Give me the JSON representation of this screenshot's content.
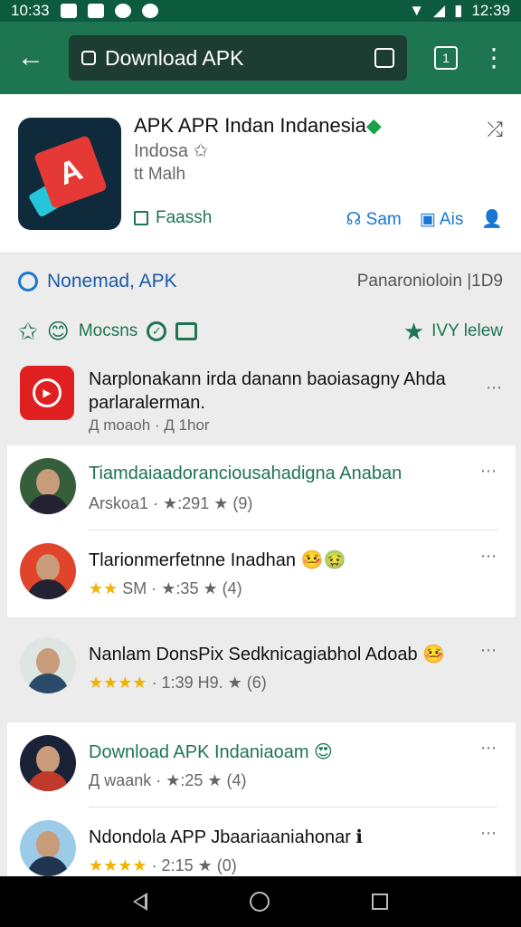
{
  "statusbar": {
    "left_time": "10:33",
    "right_time": "12:39"
  },
  "toolbar": {
    "title": "Download APK"
  },
  "app": {
    "name": "APK APR Indan Indanesia",
    "subtitle": "Indosa",
    "developer": "tt Malh",
    "fresh_label": "Faassh",
    "action_1": "Sam",
    "action_2": "Ais"
  },
  "section": {
    "title": "Nonemad, APK",
    "right": "Panaronioloin |1D9"
  },
  "filters": {
    "label": "Mocsns",
    "right": "IVY lelew"
  },
  "featured": {
    "title": "Narplonakann irda danann baoiasagny Ahda parlaralerman.",
    "meta": "Д moaoh · Д 1hor"
  },
  "items": [
    {
      "name": "Tiamdaiaadoranciousahadigna Anaban",
      "meta": "Arskoa1 · ★:291 ★ (9)"
    },
    {
      "name": "Tlarionmerfetnne Inadhan 🤒🤢",
      "stars": "★★",
      "meta": "SM · ★:35 ★ (4)"
    },
    {
      "name": "Nanlam DonsPix Sedknicagiabhol Adoab 🤒",
      "stars": "★★★★",
      "meta": "· 1:39 H9. ★ (6)"
    },
    {
      "name": "Download APK Indaniaoam 😍",
      "meta": "Д waank · ★:25 ★ (4)"
    },
    {
      "name": "Ndondola APP Jbaariaaniahonar ℹ",
      "stars": "★★★★",
      "meta": "· 2:15 ★ (0)"
    }
  ]
}
